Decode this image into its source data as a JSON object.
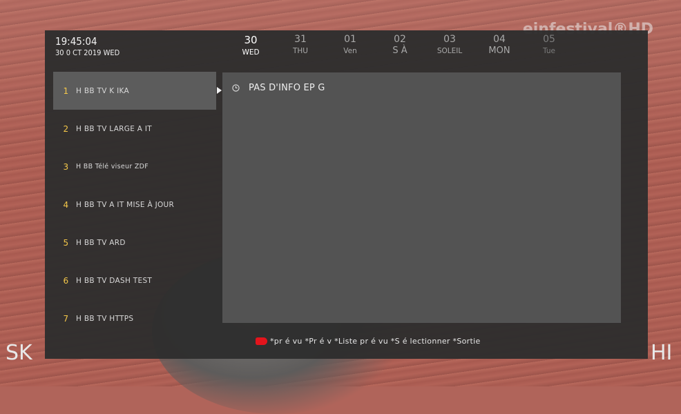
{
  "background": {
    "logo_text": "einfestival®HD",
    "ticker_left": "SK",
    "ticker_right": "HI"
  },
  "header": {
    "time": "19:45:04",
    "date": "30 0 CT 2019 WED"
  },
  "days": [
    {
      "num": "30",
      "dow": "WED",
      "state": "active"
    },
    {
      "num": "31",
      "dow": "THU",
      "state": "normal"
    },
    {
      "num": "01",
      "dow": "Ven",
      "state": "normal"
    },
    {
      "num": "02",
      "dow": "S À",
      "state": "normal"
    },
    {
      "num": "03",
      "dow": "SOLEIL",
      "state": "normal"
    },
    {
      "num": "04",
      "dow": "MON",
      "state": "normal"
    },
    {
      "num": "05",
      "dow": "Tue",
      "state": "faded"
    }
  ],
  "channels": [
    {
      "number": "1",
      "label": "H BB TV K IKA",
      "selected": true
    },
    {
      "number": "2",
      "label": "H BB TV LARGE A IT",
      "selected": false
    },
    {
      "number": "3",
      "label": "H BB Télé viseur ZDF",
      "selected": false
    },
    {
      "number": "4",
      "label": "H BB TV A IT MISE À JOUR",
      "selected": false
    },
    {
      "number": "5",
      "label": "H BB TV ARD",
      "selected": false
    },
    {
      "number": "6",
      "label": "H BB TV DASH TEST",
      "selected": false
    },
    {
      "number": "7",
      "label": "H BB TV HTTPS",
      "selected": false
    }
  ],
  "epg": {
    "message": "PAS D'INFO EP G",
    "icon": "clock-icon"
  },
  "footer": {
    "text": "*pr é vu *Pr é v *Liste pr é vu *S é lectionner *Sortie",
    "key_color": "#e3141c"
  },
  "colors": {
    "panel_bg": "#2e2e2e",
    "selected_row": "#5c5c5c",
    "epg_bg": "#535353",
    "channel_number": "#f5c84a"
  }
}
